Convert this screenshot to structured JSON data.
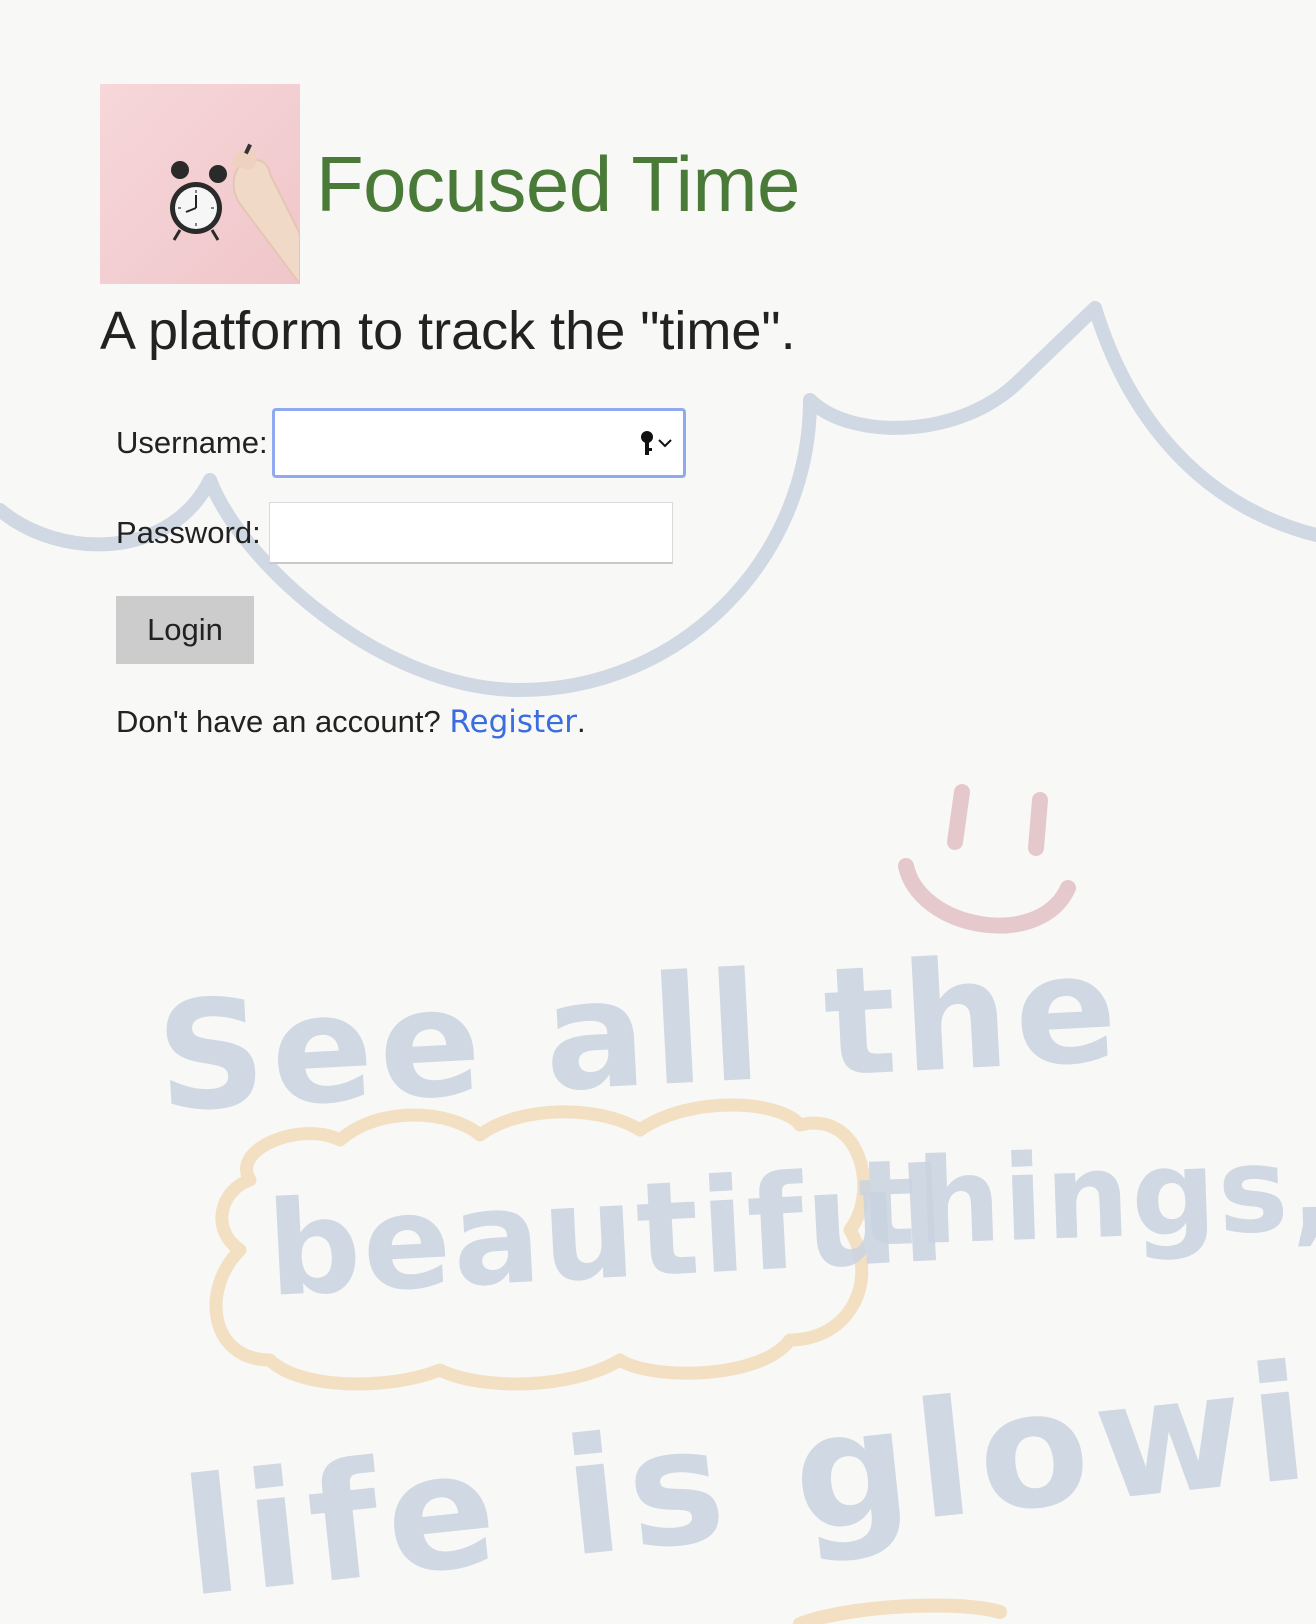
{
  "header": {
    "app_title": "Focused Time",
    "logo_icon": "alarm-clock-photo"
  },
  "tagline": "A platform to track the \"time\".",
  "form": {
    "username_label": "Username:",
    "username_value": "",
    "password_label": "Password:",
    "password_value": "",
    "login_label": "Login",
    "key_icon": "password-key-icon"
  },
  "footer": {
    "prompt": "Don't have an account? ",
    "register_label": "Register",
    "trailing": "."
  },
  "background": {
    "line1": "See all the",
    "line2_word": "beautiful",
    "line2_tail": "things,",
    "line3": "life is glowing"
  },
  "colors": {
    "title_green": "#4a7a37",
    "link_blue": "#3a6de0",
    "focus_ring": "#8faaf0",
    "button_gray": "#cccccc",
    "page_bg": "#f8f8f6"
  }
}
